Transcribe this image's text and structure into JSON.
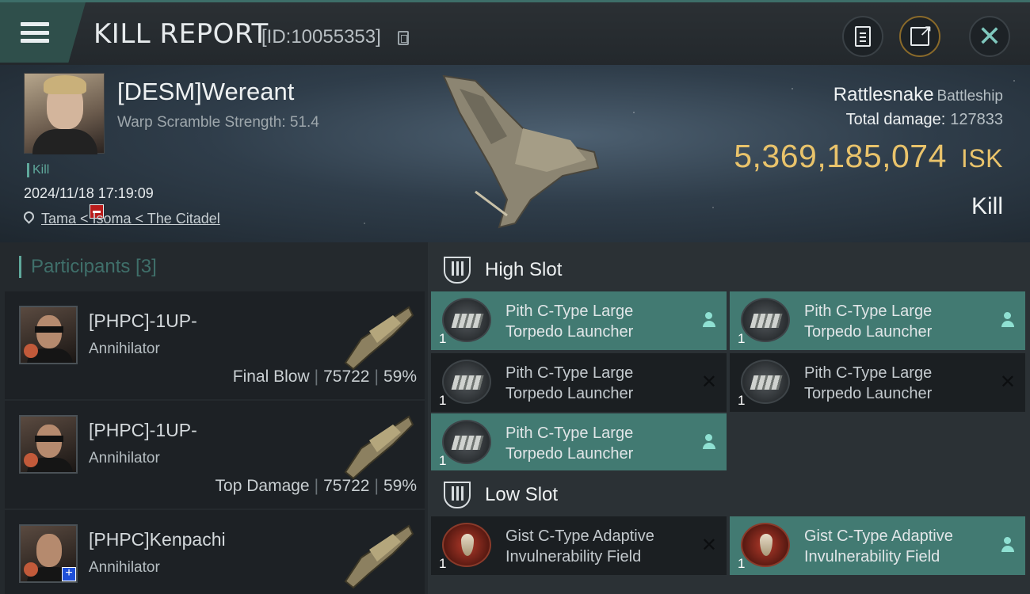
{
  "header": {
    "title": "KILL REPORT",
    "kill_id": "[ID:10055353]",
    "icons": [
      "menu-icon",
      "copy-icon",
      "clipboard-icon",
      "share-icon",
      "close-icon"
    ]
  },
  "victim": {
    "name": "[DESM]Wereant",
    "warp_scramble": "Warp Scramble Strength: 51.4",
    "tag": "Kill",
    "datetime": "2024/11/18 17:19:09",
    "location": "Tama < Isoma < The Citadel",
    "ship_name": "Rattlesnake",
    "ship_class": "Battleship",
    "total_damage_label": "Total damage:",
    "total_damage_value": "127833",
    "isk_value": "5,369,185,074",
    "isk_unit": "ISK",
    "result": "Kill"
  },
  "participants": {
    "header": "Participants [3]",
    "items": [
      {
        "name": "[PHPC]-1UP-",
        "ship": "Annihilator",
        "role": "Final Blow",
        "damage": "75722",
        "percent": "59%"
      },
      {
        "name": "[PHPC]-1UP-",
        "ship": "Annihilator",
        "role": "Top Damage",
        "damage": "75722",
        "percent": "59%"
      },
      {
        "name": "[PHPC]Kenpachi",
        "ship": "Annihilator",
        "role": "",
        "damage": "",
        "percent": ""
      }
    ]
  },
  "high_slot": {
    "title": "High Slot",
    "modules": [
      {
        "line1": "Pith C-Type Large",
        "line2": "Torpedo Launcher",
        "qty": "1",
        "status": "dropped"
      },
      {
        "line1": "Pith C-Type Large",
        "line2": "Torpedo Launcher",
        "qty": "1",
        "status": "dropped"
      },
      {
        "line1": "Pith C-Type Large",
        "line2": "Torpedo Launcher",
        "qty": "1",
        "status": "destroyed"
      },
      {
        "line1": "Pith C-Type Large",
        "line2": "Torpedo Launcher",
        "qty": "1",
        "status": "destroyed"
      },
      {
        "line1": "Pith C-Type Large",
        "line2": "Torpedo Launcher",
        "qty": "1",
        "status": "dropped"
      }
    ]
  },
  "low_slot": {
    "title": "Low Slot",
    "modules": [
      {
        "line1": "Gist C-Type Adaptive",
        "line2": "Invulnerability Field",
        "qty": "1",
        "status": "destroyed"
      },
      {
        "line1": "Gist C-Type Adaptive",
        "line2": "Invulnerability Field",
        "qty": "1",
        "status": "dropped"
      }
    ]
  },
  "colors": {
    "accent_teal": "#427a72",
    "isk_gold": "#e9c36b",
    "badge_red": "#b91c1c",
    "badge_blue": "#1e4fd8"
  }
}
